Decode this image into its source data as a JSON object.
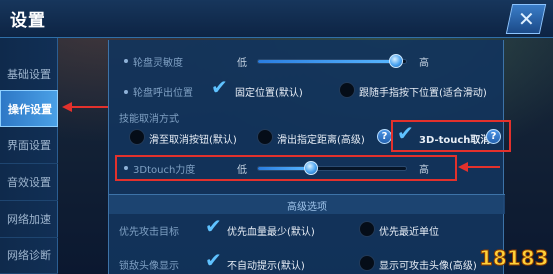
{
  "header": {
    "title": "设置",
    "close_icon": "close-x"
  },
  "sidebar": {
    "items": [
      {
        "label": "基础设置",
        "active": false
      },
      {
        "label": "操作设置",
        "active": true
      },
      {
        "label": "界面设置",
        "active": false
      },
      {
        "label": "音效设置",
        "active": false
      },
      {
        "label": "网络加速",
        "active": false
      },
      {
        "label": "网络诊断",
        "active": false
      }
    ]
  },
  "settings": {
    "wheel_sensitivity": {
      "label": "轮盘灵敏度",
      "low": "低",
      "high": "高",
      "value": 0.92
    },
    "wheel_position": {
      "label": "轮盘呼出位置",
      "option_fixed": "固定位置(默认)",
      "option_follow": "跟随手指按下位置(适合滑动)",
      "selected": "fixed"
    },
    "skill_cancel": {
      "label": "技能取消方式",
      "option_button": "滑至取消按钮(默认)",
      "option_distance": "滑出指定距离(高级)",
      "option_3dtouch": "3D-touch取消",
      "selected": "3dtouch",
      "help_glyph": "?"
    },
    "force_3dtouch": {
      "label": "3Dtouch力度",
      "low": "低",
      "high": "高",
      "value": 0.35
    },
    "advanced_title": "高级选项",
    "priority_target": {
      "label": "优先攻击目标",
      "option_lowhp": "优先血量最少(默认)",
      "option_nearest": "优先最近单位",
      "selected": "lowhp"
    },
    "lock_avatar": {
      "label": "锁敌头像显示",
      "option_auto": "不自动提示(默认)",
      "option_show": "显示可攻击头像(高级)",
      "selected": "auto"
    }
  },
  "watermark": {
    "text": "18183"
  },
  "colors": {
    "accent": "#4aa0e6",
    "highlight": "#e3312c",
    "check": "#5fc2ff"
  }
}
